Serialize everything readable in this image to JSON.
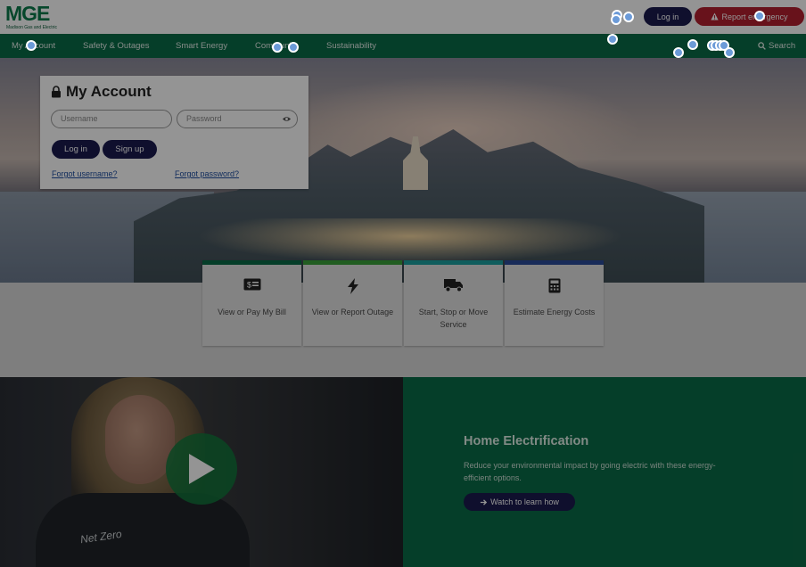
{
  "header": {
    "logo_text": "MGE",
    "logo_subtext": "Madison Gas and Electric",
    "login_label": "Log in",
    "emergency_label": "Report emergency",
    "emergency_icon": "warning-icon"
  },
  "nav": {
    "items": [
      {
        "label": "My Account"
      },
      {
        "label": "Safety & Outages"
      },
      {
        "label": "Smart Energy"
      },
      {
        "label": "Community"
      },
      {
        "label": "Sustainability"
      }
    ],
    "search_label": "Search",
    "search_icon": "search-icon"
  },
  "account": {
    "title": "My Account",
    "username_placeholder": "Username",
    "password_placeholder": "Password",
    "login_label": "Log in",
    "signup_label": "Sign up",
    "forgot_username": "Forgot username?",
    "forgot_password": "Forgot password?"
  },
  "tiles": [
    {
      "label": "View or Pay My Bill",
      "icon": "bill-icon",
      "color": "#0a6b47"
    },
    {
      "label": "View or Report Outage",
      "icon": "lightning-icon",
      "color": "#3aa03a"
    },
    {
      "label": "Start, Stop or Move Service",
      "icon": "truck-icon",
      "color": "#1aa0a0"
    },
    {
      "label": "Estimate Energy Costs",
      "icon": "calculator-icon",
      "color": "#2a4a9a"
    }
  ],
  "feature": {
    "title": "Home Electrification",
    "text": "Reduce your environmental impact by going electric with these energy-efficient options.",
    "button_label": "Watch to learn how",
    "shirt_text": "Net Zero"
  },
  "colors": {
    "brand_green": "#0a6b47",
    "navy": "#1a1a4e",
    "emergency_red": "#b4202f"
  }
}
